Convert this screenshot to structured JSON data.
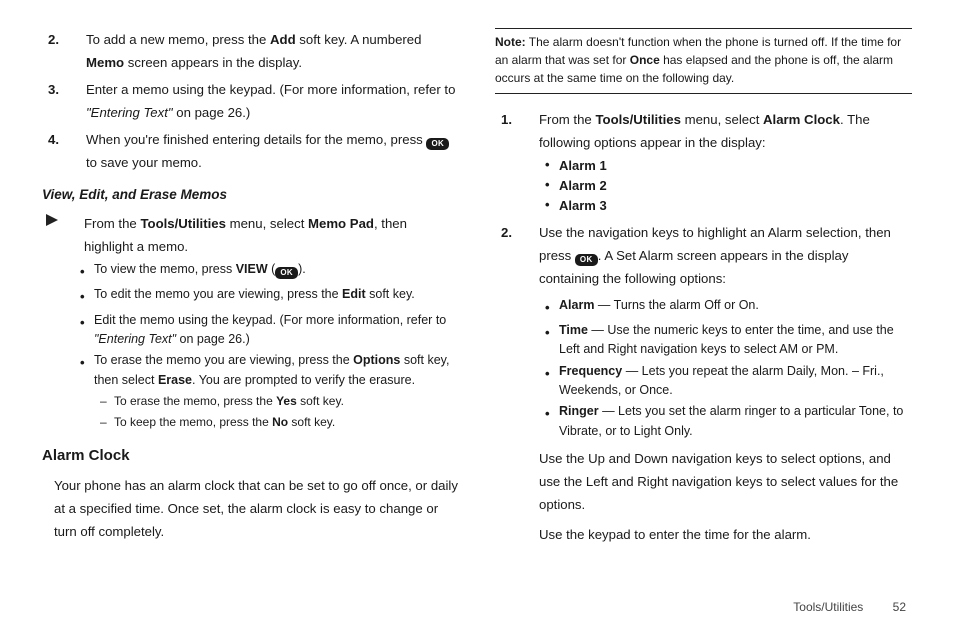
{
  "left": {
    "step2": {
      "num": "2.",
      "pre": "To add a new memo, press the ",
      "b1": "Add",
      "mid": " soft key. A numbered ",
      "b2": "Memo",
      "post": " screen appears in the display."
    },
    "step3": {
      "num": "3.",
      "pre": "Enter a memo using the keypad. (For more information, refer to ",
      "ref": "\"Entering Text\"",
      "post": "  on page 26.)"
    },
    "step4": {
      "num": "4.",
      "pre": "When you're finished entering details for the memo, press ",
      "ok": "OK",
      "post": " to save your memo."
    },
    "subhead": "View, Edit, and Erase Memos",
    "arrowRow": {
      "pre": "From the ",
      "b1": "Tools/Utilities",
      "mid": " menu, select ",
      "b2": "Memo Pad",
      "post": ", then highlight a memo."
    },
    "bullets": {
      "b1": {
        "pre": "To view the memo, press ",
        "b": "VIEW",
        "post": " (",
        "ok": "OK",
        "close": ")."
      },
      "b2": {
        "pre": "To edit the memo you are viewing, press the ",
        "b": "Edit",
        "post": " soft key."
      },
      "b3": {
        "pre": "Edit the memo using the keypad. (For more information, refer to ",
        "ref": "\"Entering Text\"",
        "post": "  on page 26.)"
      },
      "b4": {
        "pre": "To erase the memo you are viewing, press the ",
        "b": "Options",
        "post": " soft key, then select ",
        "b2": "Erase",
        "post2": ". You are prompted to verify the erasure."
      },
      "s1": {
        "pre": "To erase the memo, press the ",
        "b": "Yes",
        "post": " soft key."
      },
      "s2": {
        "pre": "To keep the memo, press the ",
        "b": "No",
        "post": " soft key."
      }
    },
    "alarmHead": "Alarm Clock",
    "alarmPara": "Your phone has an alarm clock that can be set to go off once, or daily at a specified time. Once set, the alarm clock is easy to change or turn off completely."
  },
  "right": {
    "note": {
      "label": "Note:",
      "pre": " The alarm doesn't function when the phone is turned off. If the time for an alarm that was set for ",
      "b": "Once",
      "post": " has elapsed and the phone is off, the alarm occurs at the same time on the following day."
    },
    "step1": {
      "num": "1.",
      "pre": "From the ",
      "b1": "Tools/Utilities",
      "mid": " menu, select ",
      "b2": "Alarm Clock",
      "post": ". The following options appear in the display:"
    },
    "alarms": {
      "a1": "Alarm 1",
      "a2": "Alarm 2",
      "a3": "Alarm 3"
    },
    "step2": {
      "num": "2.",
      "pre": "Use the navigation keys to highlight an Alarm selection, then press ",
      "ok": "OK",
      "post": ". A Set Alarm screen appears in the display containing the following options:"
    },
    "opts": {
      "o1": {
        "b": "Alarm",
        "post": " — Turns the alarm Off or On."
      },
      "o2": {
        "b": "Time",
        "post": " — Use the numeric keys to enter the time, and use the Left and Right navigation keys to select AM or PM."
      },
      "o3": {
        "b": "Frequency",
        "post": " — Lets you repeat the alarm Daily, Mon. – Fri., Weekends, or Once."
      },
      "o4": {
        "b": "Ringer",
        "post": " — Lets you set the alarm ringer to a particular Tone, to Vibrate, or to Light Only."
      }
    },
    "para1": "Use the Up and Down navigation keys to select options, and use the Left and Right navigation keys to select values for the options.",
    "para2": "Use the keypad to enter the time for the alarm."
  },
  "footer": {
    "section": "Tools/Utilities",
    "page": "52"
  }
}
